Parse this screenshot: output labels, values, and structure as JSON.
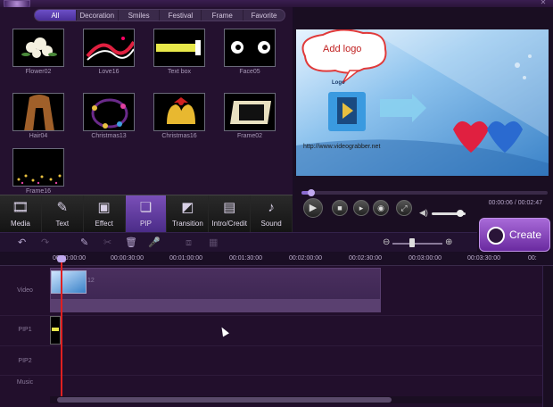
{
  "categories": {
    "tabs": [
      "All",
      "Decoration",
      "Smiles",
      "Festival",
      "Frame",
      "Favorite"
    ],
    "active": "All"
  },
  "library": {
    "items": [
      {
        "caption": "Flower02"
      },
      {
        "caption": "Love16"
      },
      {
        "caption": "Text box"
      },
      {
        "caption": "Face05"
      },
      {
        "caption": "Hair04"
      },
      {
        "caption": "Christmas13"
      },
      {
        "caption": "Christmas16"
      },
      {
        "caption": "Frame02"
      },
      {
        "caption": "Frame16"
      }
    ]
  },
  "toolbar": {
    "buttons": [
      {
        "label": "Media",
        "icon": "media-icon"
      },
      {
        "label": "Text",
        "icon": "text-icon"
      },
      {
        "label": "Effect",
        "icon": "effect-icon"
      },
      {
        "label": "PIP",
        "icon": "pip-icon"
      },
      {
        "label": "Transition",
        "icon": "transition-icon"
      },
      {
        "label": "Intro/Credit",
        "icon": "intro-credit-icon"
      },
      {
        "label": "Sound",
        "icon": "sound-icon"
      }
    ],
    "active": "PIP"
  },
  "preview": {
    "bubble_text": "Add logo",
    "logo_label": "Logo",
    "url_text": "http://www.videograbber.net",
    "timecode": "00:00:06 / 00:02:47",
    "progress_fraction": 0.04,
    "volume_fraction": 0.85
  },
  "create_button": {
    "label": "Create"
  },
  "timeline": {
    "ruler": [
      "00:00:00:00",
      "00:00:30:00",
      "00:01:00:00",
      "00:01:30:00",
      "00:02:00:00",
      "00:02:30:00",
      "00:03:00:00",
      "00:03:30:00",
      "00:"
    ],
    "tracks": [
      "Video",
      "PIP1",
      "PIP2",
      "Music"
    ],
    "video_clip_number": "12"
  },
  "colors": {
    "accent": "#6c4fc6",
    "create": "#8a4ac0",
    "playhead": "#e02020"
  }
}
